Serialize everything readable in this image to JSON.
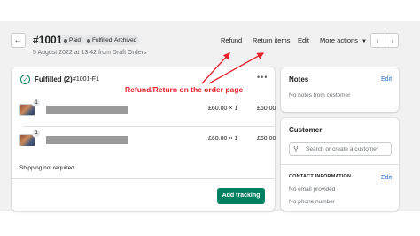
{
  "header": {
    "order_number": "#1001",
    "badges": {
      "paid": "Paid",
      "fulfilled": "Fulfilled",
      "archived": "Archived"
    },
    "subtitle": "5 August 2022 at 13:42 from Draft Orders",
    "actions": {
      "refund": "Refund",
      "return_items": "Return items",
      "edit": "Edit",
      "more_actions": "More actions"
    }
  },
  "fulfillment": {
    "title": "Fulfilled (2)",
    "code": "#1001-F1",
    "items": [
      {
        "quantity": "1",
        "price": "£60.00 × 1",
        "total": "£60.00"
      },
      {
        "quantity": "1",
        "price": "£60.00 × 1",
        "total": "£60.00"
      }
    ],
    "shipping_note": "Shipping not required.",
    "add_tracking_label": "Add tracking"
  },
  "notes": {
    "title": "Notes",
    "edit_label": "Edit",
    "empty_text": "No notes from customer"
  },
  "customer": {
    "title": "Customer",
    "search_placeholder": "Search or create a customer",
    "contact_label": "CONTACT INFORMATION",
    "contact_edit_label": "Edit",
    "no_email": "No email provided",
    "no_phone": "No phone number"
  },
  "annotation": {
    "text": "Refund/Return on the order page",
    "color": "#e8202a"
  },
  "colors": {
    "primary_button": "#008060",
    "link": "#2c6ecb",
    "fulfilled_icon": "#007f5f"
  },
  "icons": {
    "back": "arrow-left-icon",
    "fulfilled": "check-circle-icon",
    "more": "horizontal-dots-icon",
    "prev": "chevron-left-icon",
    "next": "chevron-right-icon",
    "search": "search-icon",
    "more_actions_caret": "caret-down-icon"
  }
}
